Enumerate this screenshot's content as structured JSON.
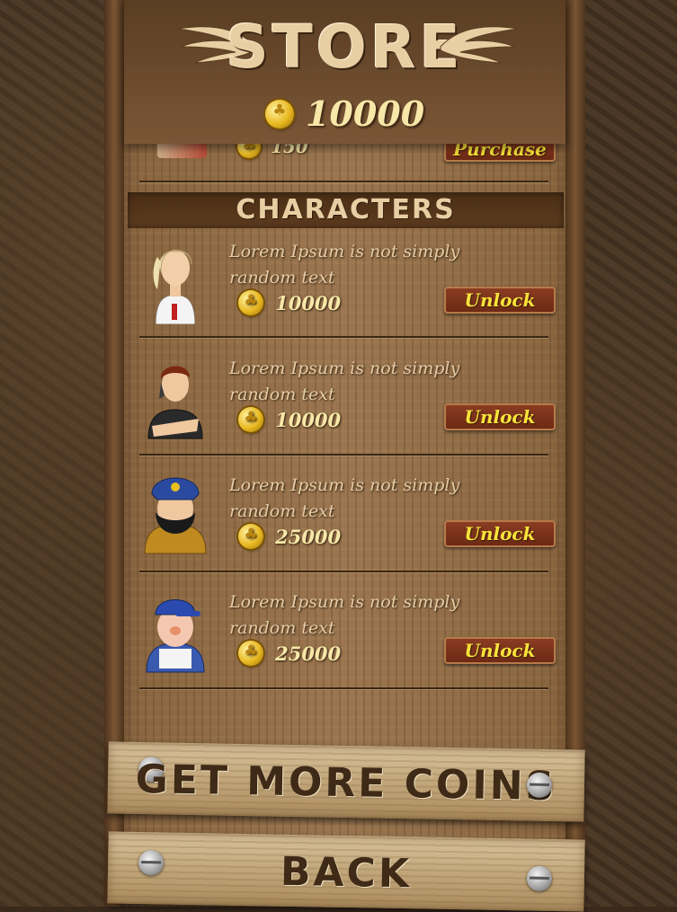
{
  "header": {
    "title": "STORE",
    "balance": "10000"
  },
  "previous_item": {
    "price": "150",
    "button_label": "Purchase"
  },
  "section": {
    "title": "CHARACTERS"
  },
  "characters": [
    {
      "description": "Lorem Ipsum is not simply random text",
      "price": "10000",
      "button_label": "Unlock",
      "avatar_icon": "blonde-woman-avatar"
    },
    {
      "description": "Lorem Ipsum is not simply random text",
      "price": "10000",
      "button_label": "Unlock",
      "avatar_icon": "man-black-shirt-avatar"
    },
    {
      "description": "Lorem Ipsum is not simply random text",
      "price": "25000",
      "button_label": "Unlock",
      "avatar_icon": "bearded-miner-avatar"
    },
    {
      "description": "Lorem Ipsum is not simply random text",
      "price": "25000",
      "button_label": "Unlock",
      "avatar_icon": "worker-blue-cap-avatar"
    }
  ],
  "footer": {
    "get_more_coins_label": "GET MORE COINS",
    "back_label": "BACK"
  },
  "colors": {
    "button_text": "#f9e33a",
    "button_bg": "#7a3218",
    "coin": "#e8b820"
  }
}
